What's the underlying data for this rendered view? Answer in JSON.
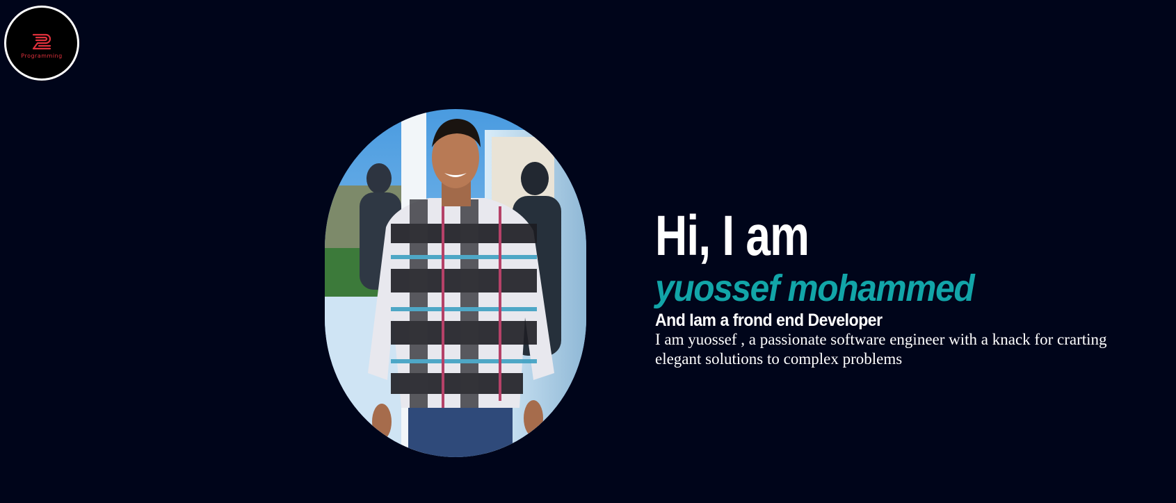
{
  "logo": {
    "text": "Programming",
    "icon": "z-programming-logo-icon",
    "color": "#e0313c"
  },
  "portrait": {
    "alt": "portrait-photo"
  },
  "intro": {
    "heading": "Hi, I am",
    "name": "yuossef mohammed",
    "role": "And Iam a frond end Developer",
    "description": "I am yuossef , a passionate software engineer with a knack for crarting elegant solutions to complex problems"
  },
  "colors": {
    "background": "#00051a",
    "accent": "#12a5a8",
    "text": "#ffffff"
  }
}
